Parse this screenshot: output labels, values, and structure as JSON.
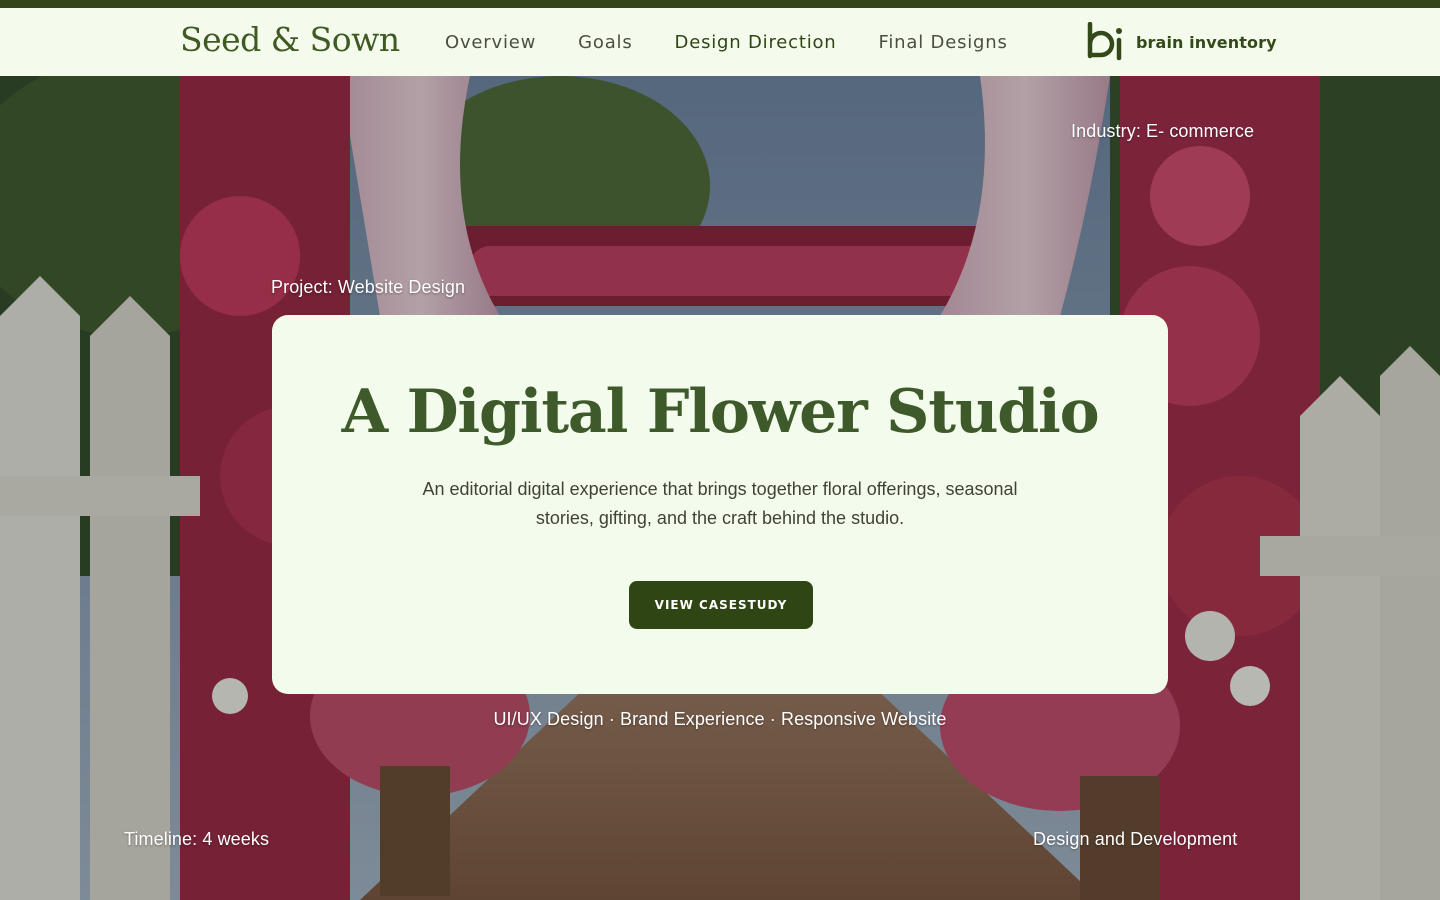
{
  "brand": {
    "name": "Seed & Sown"
  },
  "nav": {
    "links": [
      {
        "label": "Overview"
      },
      {
        "label": "Goals"
      },
      {
        "label": "Design Direction"
      },
      {
        "label": "Final Designs"
      }
    ]
  },
  "agency": {
    "name": "brain inventory",
    "logo_icon": "bi-logo-icon"
  },
  "hero": {
    "industry": "Industry: E- commerce",
    "project": "Project: Website Design",
    "title": "A Digital Flower Studio",
    "subtitle": "An editorial digital experience that brings together floral offerings, seasonal stories, gifting, and the craft behind the studio.",
    "cta_label": "VIEW CASESTUDY",
    "services": "UI/UX Design · Brand Experience · Responsive Website",
    "timeline": "Timeline: 4 weeks",
    "scope": "Design and Development"
  },
  "colors": {
    "accent": "#2f4514",
    "nav_bg": "#f4fbec",
    "card_bg": "#f3fcec",
    "title": "#3f5a2a"
  }
}
